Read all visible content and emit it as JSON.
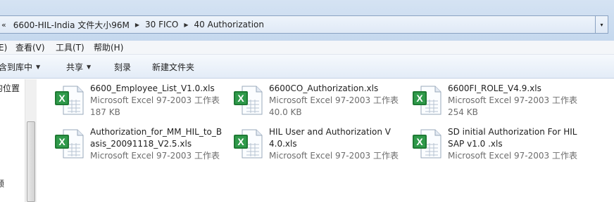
{
  "address_bar": {
    "lead_symbol": "«",
    "segments": [
      "6600-HIL-India 文件大小96M",
      "30 FICO",
      "40 Authorization"
    ],
    "dropdown_symbol": "▾"
  },
  "menu": {
    "items": [
      "E)",
      "查看(V)",
      "工具(T)",
      "帮助(H)"
    ]
  },
  "toolbar": {
    "include_label": "含到库中",
    "share_label": "共享",
    "burn_label": "刻录",
    "new_folder_label": "新建文件夹"
  },
  "nav": {
    "items": [
      "的位置",
      "频"
    ]
  },
  "files": [
    {
      "name_lines": [
        "6600_Employee_List_V1.0.xls"
      ],
      "type": "Microsoft Excel 97-2003 工作表",
      "size": "187 KB"
    },
    {
      "name_lines": [
        "6600CO_Authorization.xls"
      ],
      "type": "Microsoft Excel 97-2003 工作表",
      "size": "40.0 KB"
    },
    {
      "name_lines": [
        "6600FI_ROLE_V4.9.xls"
      ],
      "type": "Microsoft Excel 97-2003 工作表",
      "size": "254 KB"
    },
    {
      "name_lines": [
        "Authorization_for_MM_HIL_to_B",
        "asis_20091118_V2.5.xls"
      ],
      "type": "Microsoft Excel 97-2003 工作表",
      "size": ""
    },
    {
      "name_lines": [
        "HIL User and Authorization V",
        "4.0.xls"
      ],
      "type": "Microsoft Excel 97-2003 工作表",
      "size": ""
    },
    {
      "name_lines": [
        "SD initial Authorization For HIL",
        "SAP v1.0 .xls"
      ],
      "type": "Microsoft Excel 97-2003 工作表",
      "size": ""
    }
  ],
  "icons": {
    "file_icon": "excel-file-icon",
    "chevron": "chevron-right-icon"
  },
  "colors": {
    "excel_green": "#1f7a34",
    "meta_text": "#6d6d6d",
    "toolbar_bg": "#e3ecf7"
  }
}
